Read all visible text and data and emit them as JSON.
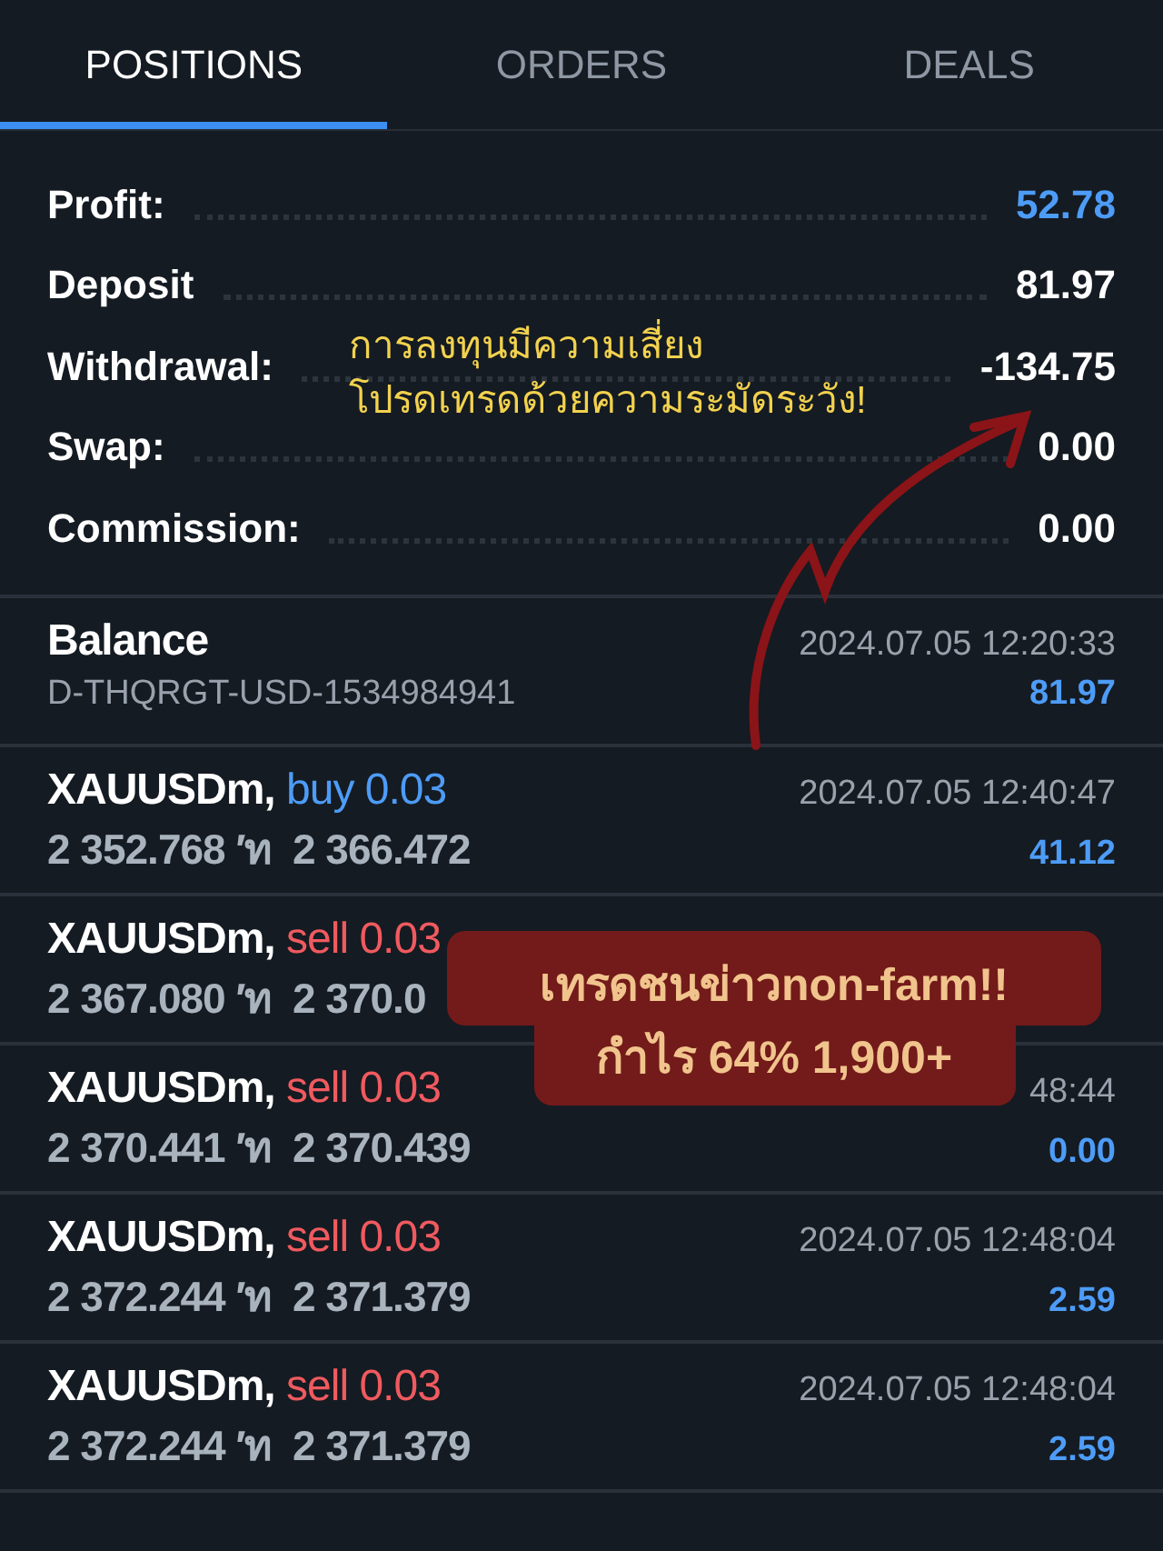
{
  "tabs": [
    {
      "label": "POSITIONS",
      "selected": true
    },
    {
      "label": "ORDERS",
      "selected": false
    },
    {
      "label": "DEALS",
      "selected": false
    }
  ],
  "summary": [
    {
      "label": "Profit:",
      "value": "52.78",
      "kind": "profit"
    },
    {
      "label": "Deposit",
      "value": "81.97",
      "kind": "plain"
    },
    {
      "label": "Withdrawal:",
      "value": "-134.75",
      "kind": "plain"
    },
    {
      "label": "Swap:",
      "value": "0.00",
      "kind": "plain"
    },
    {
      "label": "Commission:",
      "value": "0.00",
      "kind": "plain"
    }
  ],
  "balance": {
    "title": "Balance",
    "account": "D-THQRGT-USD-1534984941",
    "time": "2024.07.05 12:20:33",
    "amount": "81.97"
  },
  "positions": [
    {
      "symbol": "XAUUSDm,",
      "kind": "buy",
      "order": "buy 0.03",
      "prices": "2 352.768 ′ท  2 366.472",
      "time": "2024.07.05 12:40:47",
      "profit": "41.12"
    },
    {
      "symbol": "XAUUSDm,",
      "kind": "sell",
      "order": "sell 0.03",
      "prices": "2 367.080 ′ท  2 370.0"
    },
    {
      "symbol": "XAUUSDm,",
      "kind": "sell",
      "order": "sell 0.03",
      "prices": "2 370.441 ′ท  2 370.439",
      "time": "48:44",
      "profit": "0.00"
    },
    {
      "symbol": "XAUUSDm,",
      "kind": "sell",
      "order": "sell 0.03",
      "prices": "2 372.244 ′ท  2 371.379",
      "time": "2024.07.05 12:48:04",
      "profit": "2.59"
    },
    {
      "symbol": "XAUUSDm,",
      "kind": "sell",
      "order": "sell 0.03",
      "prices": "2 372.244 ′ท  2 371.379",
      "time": "2024.07.05 12:48:04",
      "profit": "2.59"
    }
  ],
  "warning": {
    "lines": [
      "การลงทุนมีความเสี่ยง",
      "โปรดเทรดด้วยความระมัดระวัง!"
    ]
  },
  "callout": {
    "lines": [
      "เทรดชนข่าวnon-farm!!",
      "กำไร 64% 1,900+"
    ]
  }
}
